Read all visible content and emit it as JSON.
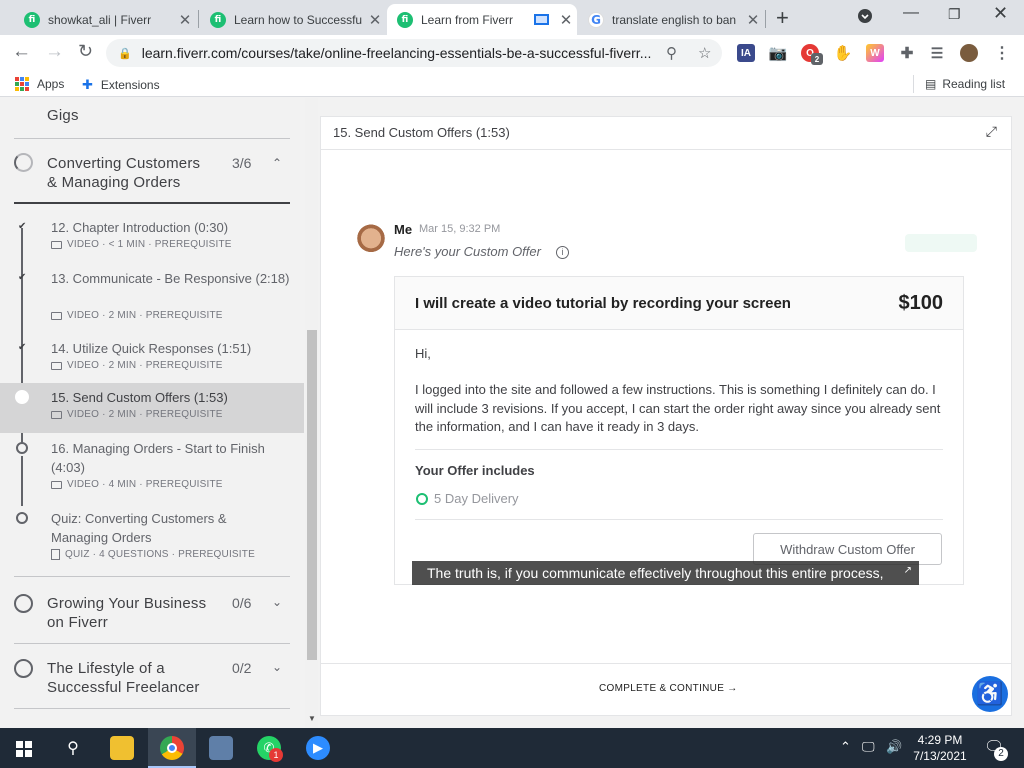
{
  "browser": {
    "tabs": [
      {
        "title": "showkat_ali | Fiverr",
        "favicon": "fi"
      },
      {
        "title": "Learn how to Successfu",
        "favicon": "fi"
      },
      {
        "title": "Learn from Fiverr",
        "favicon": "fi"
      },
      {
        "title": "translate english to ban",
        "favicon": "G"
      }
    ],
    "url": "learn.fiverr.com/courses/take/online-freelancing-essentials-be-a-successful-fiverr...",
    "bookmarks": {
      "apps": "Apps",
      "extensions": "Extensions",
      "reading_list": "Reading list"
    },
    "ext_ia": "IA",
    "ext_badge": "2"
  },
  "sidebar": {
    "prev_section_tail": "Gigs",
    "sections": [
      {
        "title_line1": "Converting Customers",
        "title_line2": "& Managing Orders",
        "count": "3/6"
      },
      {
        "title_line1": "Growing Your Business",
        "title_line2": "on Fiverr",
        "count": "0/6"
      },
      {
        "title_line1": "The Lifestyle of a",
        "title_line2": "Successful Freelancer",
        "count": "0/2"
      }
    ],
    "lessons": [
      {
        "title": "12. Chapter Introduction (0:30)",
        "meta": "VIDEO · < 1 MIN · PREREQUISITE"
      },
      {
        "title": "13. Communicate - Be Responsive (2:18)",
        "meta": "VIDEO · 2 MIN · PREREQUISITE"
      },
      {
        "title": "14. Utilize Quick Responses (1:51)",
        "meta": "VIDEO · 2 MIN · PREREQUISITE"
      },
      {
        "title": "15. Send Custom Offers (1:53)",
        "meta": "VIDEO · 2 MIN · PREREQUISITE"
      },
      {
        "title": "16. Managing Orders - Start to Finish (4:03)",
        "meta": "VIDEO · 4 MIN · PREREQUISITE"
      },
      {
        "title": "Quiz: Converting Customers & Managing Orders",
        "meta": "QUIZ · 4 QUESTIONS · PREREQUISITE"
      }
    ]
  },
  "main": {
    "title": "15. Send Custom Offers (1:53)",
    "message": {
      "sender": "Me",
      "time": "Mar 15, 9:32 PM",
      "subtitle": "Here's your Custom Offer"
    },
    "offer": {
      "title": "I will create a video tutorial by recording your screen",
      "price": "$100",
      "greeting": "Hi,",
      "description": "I logged into the site and followed a few instructions. This is something I definitely can do. I will include 3 revisions. If you accept, I can start the order right away since you already sent the information, and I can have it ready in 3 days.",
      "includes_title": "Your Offer includes",
      "delivery": "5 Day Delivery",
      "withdraw_label": "Withdraw Custom Offer"
    },
    "caption": "The truth is, if you communicate effectively throughout this entire process,",
    "complete_label": "COMPLETE & CONTINUE →"
  },
  "taskbar": {
    "whatsapp_badge": "1",
    "time": "4:29 PM",
    "date": "7/13/2021",
    "notification_count": "2"
  },
  "colors": {
    "fiverr_green": "#1dbf73",
    "accessibility_blue": "#1a6fe0",
    "taskbar_bg": "#1f2a37"
  }
}
